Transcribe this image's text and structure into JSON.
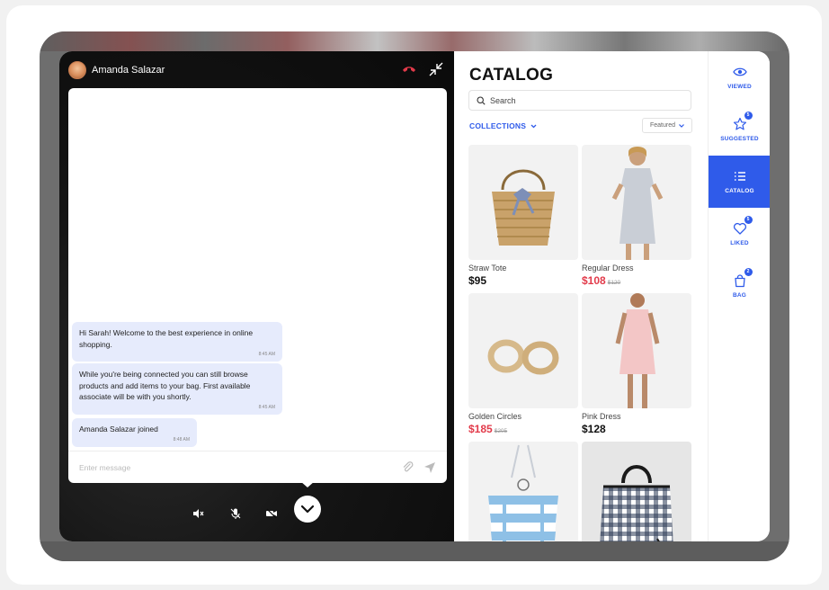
{
  "call": {
    "caller_name": "Amanda Salazar"
  },
  "chat": {
    "messages": [
      {
        "text": "Hi Sarah! Welcome to the best experience in online shopping.",
        "time": "8:45 AM"
      },
      {
        "text": "While you're being connected you can still browse products and add items to your bag. First available associate will be with you shortly.",
        "time": "8:45 AM"
      },
      {
        "text": "Amanda Salazar joined",
        "time": "8:48 AM"
      }
    ],
    "input_placeholder": "Enter message"
  },
  "catalog": {
    "title": "CATALOG",
    "search_placeholder": "Search",
    "collections_label": "COLLECTIONS",
    "sort_label": "Featured",
    "products": [
      {
        "name": "Straw Tote",
        "price": "$95",
        "old_price": ""
      },
      {
        "name": "Regular Dress",
        "price": "$108",
        "old_price": "$120"
      },
      {
        "name": "Golden Circles",
        "price": "$185",
        "old_price": "$205"
      },
      {
        "name": "Pink Dress",
        "price": "$128",
        "old_price": ""
      },
      {
        "name": "",
        "price": "",
        "old_price": ""
      },
      {
        "name": "",
        "price": "",
        "old_price": ""
      }
    ]
  },
  "sidenav": {
    "items": [
      {
        "label": "VIEWED",
        "icon": "eye-icon",
        "badge": ""
      },
      {
        "label": "SUGGESTED",
        "icon": "star-icon",
        "badge": "5"
      },
      {
        "label": "CATALOG",
        "icon": "list-icon",
        "badge": ""
      },
      {
        "label": "LIKED",
        "icon": "heart-icon",
        "badge": "5"
      },
      {
        "label": "BAG",
        "icon": "bag-icon",
        "badge": "2"
      }
    ]
  },
  "colors": {
    "accent": "#2f5bea",
    "sale": "#e23a4a",
    "chat_bubble": "#e6ebfc"
  }
}
